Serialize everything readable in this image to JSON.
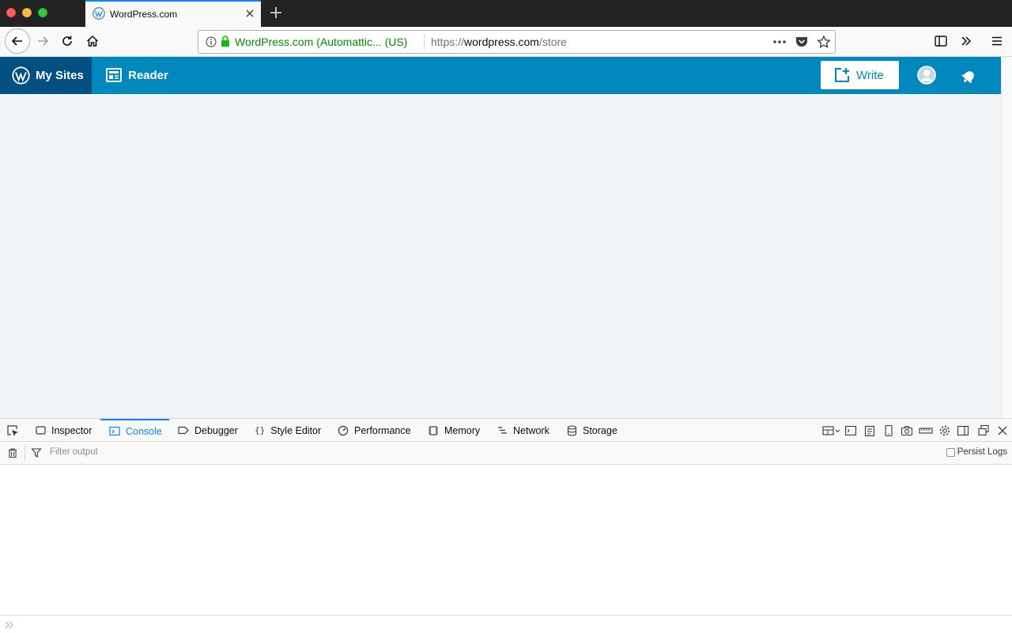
{
  "browser": {
    "tab": {
      "title": "WordPress.com",
      "favicon": "wordpress-favicon-icon",
      "close": "close-tab-icon"
    },
    "new_tab": "plus-icon",
    "url": {
      "identity": "WordPress.com (Automattic...  (US)",
      "scheme": "https://",
      "host": "wordpress.com",
      "path": "/store"
    },
    "colors": {
      "accent": "#0a84ff",
      "secure_green": "#058b00"
    }
  },
  "masterbar": {
    "my_sites": "My Sites",
    "reader": "Reader",
    "write": "Write",
    "colors": {
      "bar": "#0087be",
      "active": "#005082"
    }
  },
  "devtools": {
    "tabs": [
      {
        "label": "Inspector",
        "icon": "inspector-icon"
      },
      {
        "label": "Console",
        "icon": "console-icon",
        "selected": true
      },
      {
        "label": "Debugger",
        "icon": "debugger-icon"
      },
      {
        "label": "Style Editor",
        "icon": "style-editor-icon"
      },
      {
        "label": "Performance",
        "icon": "performance-icon"
      },
      {
        "label": "Memory",
        "icon": "memory-icon"
      },
      {
        "label": "Network",
        "icon": "network-icon"
      },
      {
        "label": "Storage",
        "icon": "storage-icon"
      }
    ],
    "filter_placeholder": "Filter output",
    "persist_logs": "Persist Logs",
    "persist_checked": false
  }
}
